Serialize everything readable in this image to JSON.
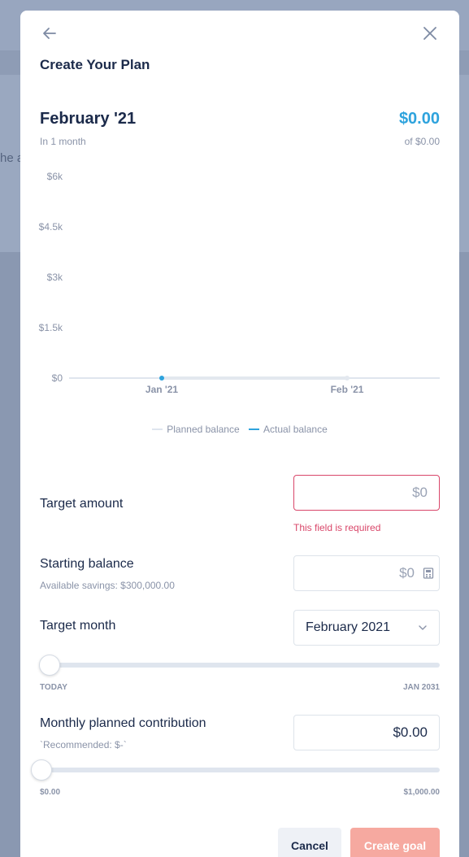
{
  "background": {
    "partial_text": "he a"
  },
  "modal": {
    "title": "Create Your Plan",
    "back_icon": "arrow-left-icon",
    "close_icon": "close-icon"
  },
  "summary": {
    "month": "February '21",
    "subtext": "In 1 month",
    "amount": "$0.00",
    "amount_sub": "of $0.00"
  },
  "chart_data": {
    "type": "line",
    "x": [
      "Jan '21",
      "Feb '21"
    ],
    "y_ticks": [
      "$6k",
      "$4.5k",
      "$3k",
      "$1.5k",
      "$0"
    ],
    "ylim": [
      0,
      6000
    ],
    "series": [
      {
        "name": "Planned balance",
        "values": [
          0,
          0
        ],
        "color": "#dfe5ee"
      },
      {
        "name": "Actual balance",
        "values": [
          0,
          null
        ],
        "color": "#2ea3dd"
      }
    ],
    "grid": false,
    "legend": "bottom-center"
  },
  "form": {
    "target_amount": {
      "label": "Target amount",
      "value": "",
      "placeholder": "$0",
      "error": "This field is required"
    },
    "starting_balance": {
      "label": "Starting balance",
      "hint": "Available savings: $300,000.00",
      "value": "",
      "placeholder": "$0",
      "icon": "calculator-icon"
    },
    "target_month": {
      "label": "Target month",
      "selected": "February 2021",
      "slider_min": "TODAY",
      "slider_max": "JAN 2031",
      "slider_position": 0.02
    },
    "monthly_contribution": {
      "label": "Monthly planned contribution",
      "hint": "`Recommended: $-`",
      "value": "$0.00",
      "slider_min": "$0.00",
      "slider_max": "$1,000.00",
      "slider_position": 0
    }
  },
  "actions": {
    "cancel": "Cancel",
    "create": "Create goal"
  },
  "colors": {
    "accent": "#2ea3dd",
    "error": "#d9476a",
    "primary_disabled": "#f6a9a0",
    "text": "#1b2a4a"
  }
}
